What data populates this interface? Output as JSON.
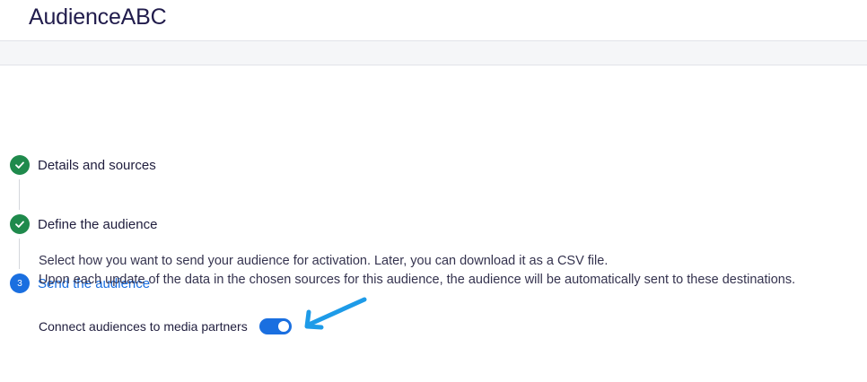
{
  "app": {
    "title": "AudienceABC"
  },
  "steps": [
    {
      "label": "Details and sources",
      "state": "done",
      "icon": "check-icon"
    },
    {
      "label": "Define the audience",
      "state": "done",
      "icon": "check-icon"
    },
    {
      "label": "Send the audience",
      "state": "active",
      "number": "3"
    }
  ],
  "send": {
    "line1": "Select how you want to send your audience for activation. Later, you can download it as a CSV file.",
    "line2": "Upon each update of the data in the chosen sources for this audience, the audience will be automatically sent to these destinations.",
    "toggle_label": "Connect audiences to media partners",
    "toggle_on": true
  },
  "colors": {
    "accent": "#1a6fe0",
    "success": "#1f8a4c",
    "annotation_arrow": "#1e9be8"
  }
}
